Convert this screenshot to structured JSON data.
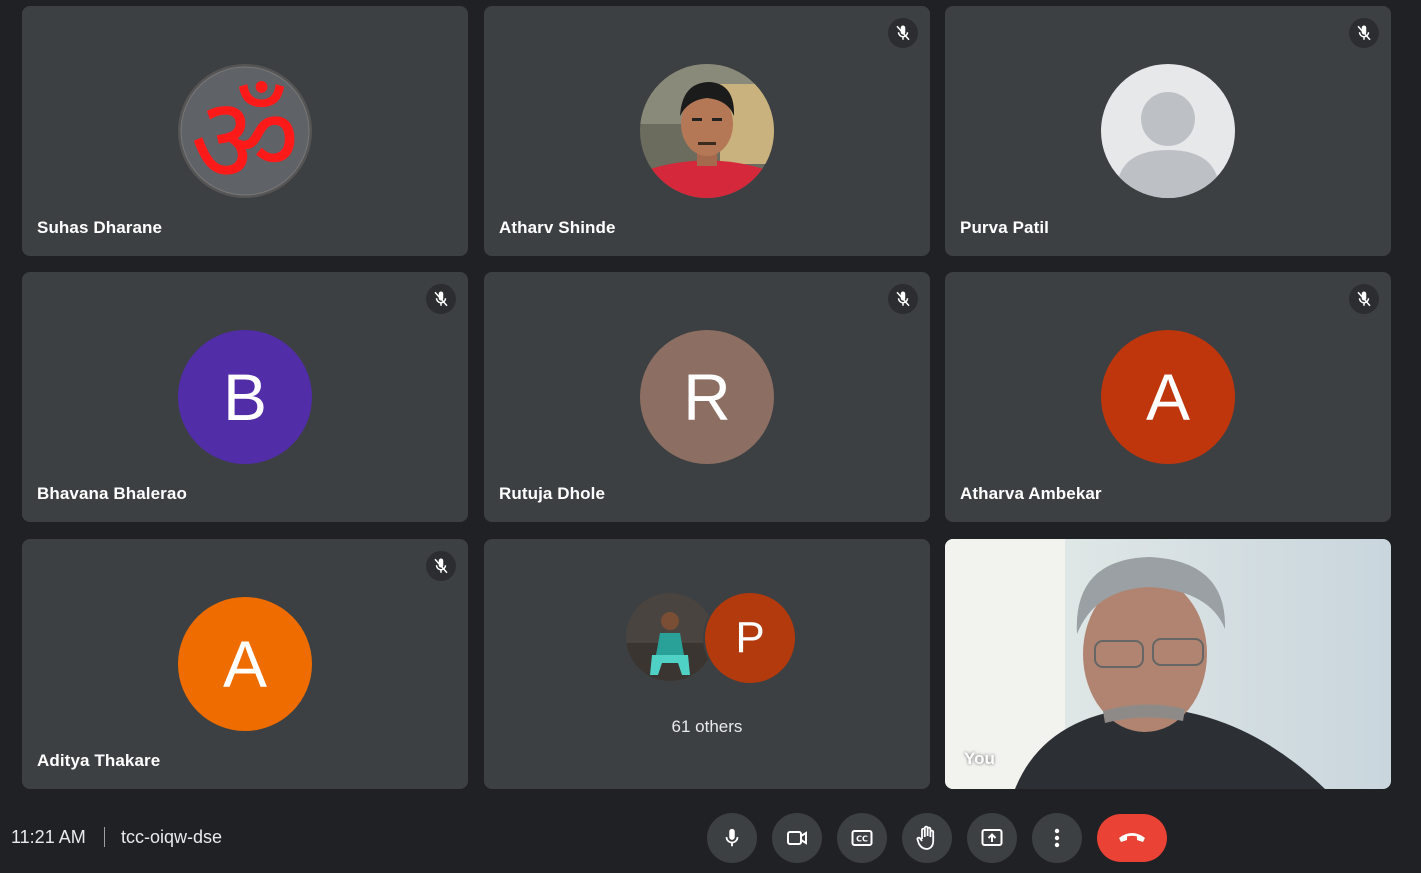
{
  "participants": [
    {
      "name": "Suhas Dharane",
      "avatar": "om-symbol"
    },
    {
      "name": "Atharv Shinde",
      "avatar": "photo"
    },
    {
      "name": "Purva Patil",
      "avatar": "default-person"
    },
    {
      "name": "Bhavana Bhalerao",
      "initial": "B",
      "color": "#512da8"
    },
    {
      "name": "Rutuja Dhole",
      "initial": "R",
      "color": "#8d6e63"
    },
    {
      "name": "Atharva Ambekar",
      "initial": "A",
      "color": "#bf360c"
    },
    {
      "name": "Aditya Thakare",
      "initial": "A",
      "color": "#ef6c00"
    }
  ],
  "others": {
    "label": "61 others",
    "initial": "P"
  },
  "self_tile": {
    "label": "You"
  },
  "bottom_bar": {
    "time": "11:21 AM",
    "meeting_code": "tcc-oiqw-dse"
  },
  "controls": [
    "microphone",
    "camera",
    "captions",
    "raise-hand",
    "present",
    "more-options",
    "leave-call"
  ],
  "colors": {
    "background": "#202124",
    "tile": "#3c4043",
    "leave": "#ea4335"
  }
}
